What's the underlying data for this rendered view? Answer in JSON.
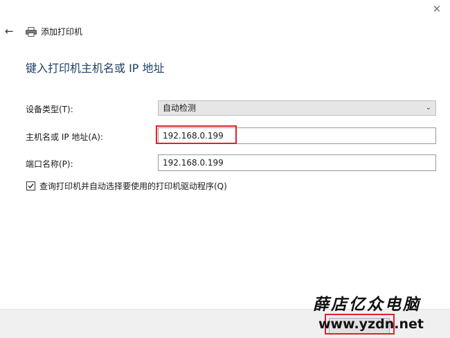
{
  "window": {
    "close_glyph": "✕",
    "back_glyph": "←",
    "title": "添加打印机"
  },
  "heading": "键入打印机主机名或 IP 地址",
  "fields": {
    "device_type": {
      "label": "设备类型(T):",
      "value": "自动检测",
      "chevron": "⌄"
    },
    "hostname": {
      "label": "主机名或 IP 地址(A):",
      "value": "192.168.0.199"
    },
    "port_name": {
      "label": "端口名称(P):",
      "value": "192.168.0.199"
    }
  },
  "query_printer": {
    "checked": true,
    "label": "查询打印机并自动选择要使用的打印机驱动程序(Q)"
  },
  "watermark": {
    "text": "薛店亿众电脑",
    "url": "www.yzdn.net"
  },
  "colors": {
    "heading": "#1e3f66",
    "highlight": "#e0202a",
    "select_bg": "#e6e6e6",
    "footer_bg": "#f0f0f0"
  },
  "icons": {
    "close": "close-icon",
    "back": "back-arrow-icon",
    "printer": "printer-icon",
    "chevron": "chevron-down-icon",
    "checkmark": "checkmark-icon"
  }
}
